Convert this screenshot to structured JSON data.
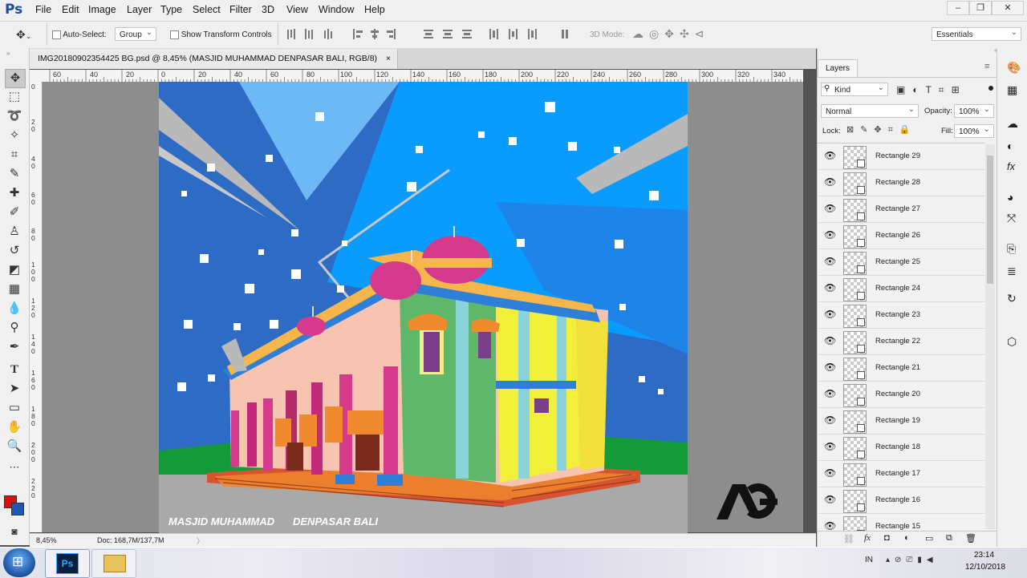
{
  "app": {
    "logo": "Ps",
    "menu": [
      "File",
      "Edit",
      "Image",
      "Layer",
      "Type",
      "Select",
      "Filter",
      "3D",
      "View",
      "Window",
      "Help"
    ],
    "window_controls": [
      "–",
      "❐",
      "✕"
    ]
  },
  "options": {
    "auto_select_label": "Auto-Select:",
    "auto_select_value": "Group",
    "transform_label": "Show Transform Controls",
    "mode_3d_label": "3D Mode:",
    "workspace_value": "Essentials"
  },
  "document": {
    "tab_title": "IMG20180902354425 BG.psd @ 8,45% (MASJID MUHAMMAD  DENPASAR BALI, RGB/8)",
    "tab_close": "×",
    "zoom": "8,45%",
    "doc_size": "Doc: 168,7M/137,7M",
    "status_arrow": "〉"
  },
  "ruler": {
    "top_labels": [
      "60",
      "40",
      "20",
      "0",
      "20",
      "40",
      "60",
      "80",
      "100",
      "120",
      "140",
      "160",
      "180",
      "200",
      "220",
      "240",
      "260",
      "280",
      "300",
      "320",
      "340"
    ],
    "left_labels": [
      "0",
      "20",
      "40",
      "60",
      "80",
      "100",
      "120",
      "140",
      "160",
      "180",
      "200",
      "220"
    ]
  },
  "artwork": {
    "caption_left": "MASJID MUHAMMAD",
    "caption_right": "DENPASAR BALI",
    "logo_text": "AG",
    "colors": {
      "sky_dark": "#2d6bc4",
      "sky_light": "#0a9bff",
      "ray_light": "#6db9f5",
      "ground_grey": "#a9a9a9",
      "grass": "#159a3a",
      "dome": "#d63a8c"
    }
  },
  "layers_panel": {
    "tab": "Layers",
    "filter_kind": "Kind",
    "blend_mode": "Normal",
    "opacity_label": "Opacity:",
    "opacity_value": "100%",
    "lock_label": "Lock:",
    "fill_label": "Fill:",
    "fill_value": "100%",
    "layers": [
      "Rectangle 29",
      "Rectangle 28",
      "Rectangle 27",
      "Rectangle 26",
      "Rectangle 25",
      "Rectangle 24",
      "Rectangle 23",
      "Rectangle 22",
      "Rectangle 21",
      "Rectangle 20",
      "Rectangle 19",
      "Rectangle 18",
      "Rectangle 17",
      "Rectangle 16",
      "Rectangle 15"
    ],
    "footer_icons": [
      "link-icon",
      "fx-icon",
      "mask-icon",
      "adjustment-icon",
      "folder-icon",
      "new-layer-icon",
      "trash-icon"
    ]
  },
  "taskbar": {
    "tray_lang": "IN",
    "time": "23:14",
    "date": "12/10/2018"
  }
}
